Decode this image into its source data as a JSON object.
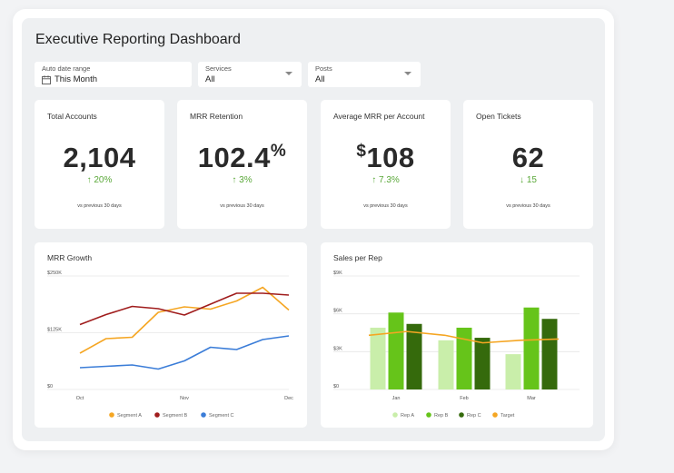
{
  "title": "Executive Reporting Dashboard",
  "filters": [
    {
      "label": "Auto date range",
      "value": "This Month",
      "icon": "calendar-icon"
    },
    {
      "label": "Services",
      "value": "All"
    },
    {
      "label": "Posts",
      "value": "All"
    }
  ],
  "kpis": [
    {
      "label": "Total Accounts",
      "value": "2,104",
      "prefix": "",
      "suffix": "",
      "delta": "↑ 20%",
      "note": "vs previous 30 days"
    },
    {
      "label": "MRR Retention",
      "value": "102.4",
      "prefix": "",
      "suffix": "%",
      "delta": "↑ 3%",
      "note": "vs previous 30 days"
    },
    {
      "label": "Average MRR per Account",
      "value": "108",
      "prefix": "$",
      "suffix": "",
      "delta": "↑ 7.3%",
      "note": "vs previous 30 days"
    },
    {
      "label": "Open Tickets",
      "value": "62",
      "prefix": "",
      "suffix": "",
      "delta": "↓ 15",
      "note": "vs previous 30 days"
    }
  ],
  "colors": {
    "positive": "#5aa839",
    "segment_a": "#f5a623",
    "segment_b": "#a01d1d",
    "segment_c": "#3b7dd8",
    "rep_a": "#c9eeaa",
    "rep_b": "#66c41a",
    "rep_c": "#356a0c",
    "target": "#f5a623",
    "grid": "#e6e6e6"
  },
  "chart_data": [
    {
      "type": "line",
      "title": "MRR Growth",
      "x": [
        "Oct",
        "",
        "",
        "",
        "Nov",
        "",
        "",
        "",
        "Dec"
      ],
      "x_ticks": [
        "Oct",
        "Nov",
        "Dec"
      ],
      "y_ticks": [
        "$0",
        "$125K",
        "$250K"
      ],
      "ylim": [
        0,
        250000
      ],
      "grid": true,
      "legend": "bottom",
      "series": [
        {
          "name": "Segment A",
          "values": [
            80000,
            112000,
            115000,
            170000,
            182000,
            177000,
            195000,
            225000,
            175000
          ]
        },
        {
          "name": "Segment B",
          "values": [
            143000,
            165000,
            183000,
            178000,
            164000,
            188000,
            212000,
            212000,
            208000
          ]
        },
        {
          "name": "Segment C",
          "values": [
            48000,
            51000,
            54000,
            45000,
            63000,
            93000,
            88000,
            110000,
            118000
          ]
        }
      ]
    },
    {
      "type": "bar",
      "title": "Sales per Rep",
      "categories": [
        "Jan",
        "Feb",
        "Mar"
      ],
      "y_ticks": [
        "$0",
        "$3K",
        "$6K",
        "$9K"
      ],
      "ylim": [
        0,
        9000
      ],
      "grid": true,
      "legend": "bottom",
      "series": [
        {
          "name": "Rep A",
          "values": [
            4900,
            3900,
            2800
          ]
        },
        {
          "name": "Rep B",
          "values": [
            6100,
            4900,
            6500
          ]
        },
        {
          "name": "Rep C",
          "values": [
            5200,
            4100,
            5600
          ]
        }
      ],
      "line_series": {
        "name": "Target",
        "values": [
          4300,
          4600,
          4300,
          3700,
          3900,
          4000
        ]
      }
    }
  ]
}
